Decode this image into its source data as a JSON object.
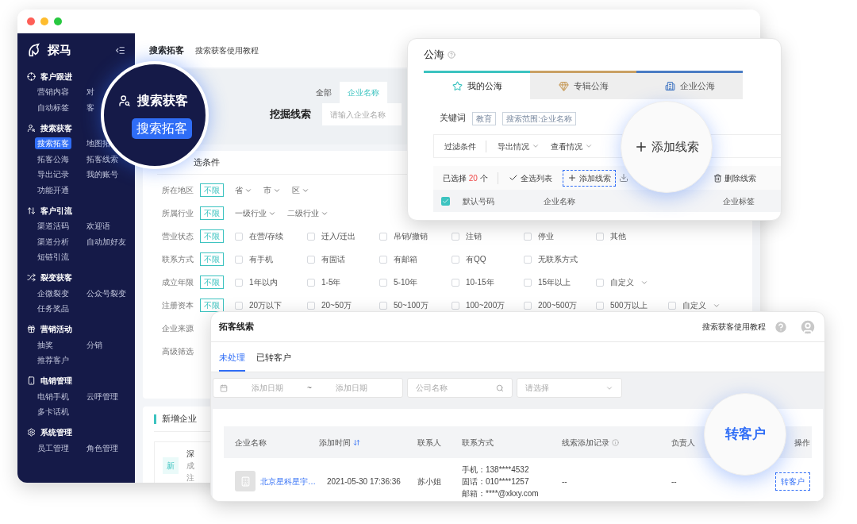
{
  "main_window": {
    "sidebar": {
      "logo": "探马",
      "groups": [
        {
          "title": "客户跟进",
          "items": [
            {
              "label": "营销内容",
              "selected": false
            },
            {
              "label": "对",
              "selected": false
            },
            {
              "label": "自动标签",
              "selected": false
            },
            {
              "label": "客",
              "selected": false
            }
          ]
        },
        {
          "title": "搜索获客",
          "items": [
            {
              "label": "搜索拓客",
              "selected": true
            },
            {
              "label": "地图拓",
              "selected": false
            },
            {
              "label": "拓客公海",
              "selected": false
            },
            {
              "label": "拓客线索",
              "selected": false
            },
            {
              "label": "导出记录",
              "selected": false
            },
            {
              "label": "我的账号",
              "selected": false
            },
            {
              "label": "功能开通",
              "selected": false
            }
          ]
        },
        {
          "title": "客户引流",
          "items": [
            {
              "label": "渠道活码",
              "selected": false
            },
            {
              "label": "欢迎语",
              "selected": false
            },
            {
              "label": "渠道分析",
              "selected": false
            },
            {
              "label": "自动加好友",
              "selected": false
            },
            {
              "label": "短链引流",
              "selected": false
            }
          ]
        },
        {
          "title": "裂变获客",
          "items": [
            {
              "label": "企微裂变",
              "selected": false
            },
            {
              "label": "公众号裂变",
              "selected": false
            },
            {
              "label": "任务奖品",
              "selected": false
            }
          ]
        },
        {
          "title": "营销活动",
          "items": [
            {
              "label": "抽奖",
              "selected": false
            },
            {
              "label": "分销",
              "selected": false
            },
            {
              "label": "推荐客户",
              "selected": false
            }
          ]
        },
        {
          "title": "电销管理",
          "items": [
            {
              "label": "电销手机",
              "selected": false
            },
            {
              "label": "云呼管理",
              "selected": false
            },
            {
              "label": "多卡话机",
              "selected": false
            }
          ]
        },
        {
          "title": "系统管理",
          "items": [
            {
              "label": "员工管理",
              "selected": false
            },
            {
              "label": "角色管理",
              "selected": false
            }
          ]
        }
      ]
    },
    "header": {
      "title": "搜索拓客",
      "link": "搜索获客使用教程"
    },
    "search": {
      "tabs": [
        {
          "label": "全部",
          "selected": false
        },
        {
          "label": "企业名称",
          "selected": true
        }
      ],
      "label": "挖掘线索",
      "placeholder": "请输入企业名称"
    },
    "filters": {
      "title": "选条件",
      "rows": [
        {
          "label": "所在地区",
          "tag": "不限",
          "options": [
            {
              "kind": "dropdown",
              "label": "省"
            },
            {
              "kind": "dropdown",
              "label": "市"
            },
            {
              "kind": "dropdown",
              "label": "区"
            }
          ]
        },
        {
          "label": "所属行业",
          "tag": "不限",
          "options": [
            {
              "kind": "dropdown",
              "label": "一级行业"
            },
            {
              "kind": "dropdown",
              "label": "二级行业"
            }
          ]
        },
        {
          "label": "营业状态",
          "tag": "不限",
          "options": [
            {
              "kind": "checkbox",
              "label": "在营/存续",
              "checked": false
            },
            {
              "kind": "checkbox",
              "label": "迁入/迁出",
              "checked": false
            },
            {
              "kind": "checkbox",
              "label": "吊销/撤销",
              "checked": false
            },
            {
              "kind": "checkbox",
              "label": "注销",
              "checked": false
            },
            {
              "kind": "checkbox",
              "label": "停业",
              "checked": false
            },
            {
              "kind": "checkbox",
              "label": "其他",
              "checked": false
            }
          ]
        },
        {
          "label": "联系方式",
          "tag": "不限",
          "options": [
            {
              "kind": "checkbox",
              "label": "有手机",
              "checked": false
            },
            {
              "kind": "checkbox",
              "label": "有固话",
              "checked": false
            },
            {
              "kind": "checkbox",
              "label": "有邮箱",
              "checked": false
            },
            {
              "kind": "checkbox",
              "label": "有QQ",
              "checked": false
            },
            {
              "kind": "checkbox",
              "label": "无联系方式",
              "checked": false
            }
          ]
        },
        {
          "label": "成立年限",
          "tag": "不限",
          "options": [
            {
              "kind": "checkbox",
              "label": "1年以内",
              "checked": false
            },
            {
              "kind": "checkbox",
              "label": "1-5年",
              "checked": false
            },
            {
              "kind": "checkbox",
              "label": "5-10年",
              "checked": false
            },
            {
              "kind": "checkbox",
              "label": "10-15年",
              "checked": false
            },
            {
              "kind": "checkbox",
              "label": "15年以上",
              "checked": false
            },
            {
              "kind": "checkbox_dropdown",
              "label": "自定义",
              "checked": false
            }
          ]
        },
        {
          "label": "注册资本",
          "tag": "不限",
          "options": [
            {
              "kind": "checkbox",
              "label": "20万以下",
              "checked": false
            },
            {
              "kind": "checkbox",
              "label": "20~50万",
              "checked": false
            },
            {
              "kind": "checkbox",
              "label": "50~100万",
              "checked": false
            },
            {
              "kind": "checkbox",
              "label": "100~200万",
              "checked": false
            },
            {
              "kind": "checkbox",
              "label": "200~500万",
              "checked": false
            },
            {
              "kind": "checkbox",
              "label": "500万以上",
              "checked": false
            },
            {
              "kind": "checkbox_dropdown",
              "label": "自定义",
              "checked": false
            }
          ]
        },
        {
          "label": "企业来源"
        },
        {
          "label": "高级筛选"
        }
      ]
    },
    "new_companies": {
      "title": "新增企业",
      "badge": "新",
      "texts": [
        "深",
        "成",
        "注"
      ]
    }
  },
  "magnifier": {
    "heading": "搜索获客",
    "pill": "搜索拓客"
  },
  "public_pool": {
    "title": "公海",
    "tabs": [
      {
        "label": "我的公海",
        "selected": true,
        "color": "#3cc3c0"
      },
      {
        "label": "专辑公海",
        "selected": false,
        "color": "#c9a063"
      },
      {
        "label": "企业公海",
        "selected": false,
        "color": "#4a7cc4"
      }
    ],
    "keyword": {
      "label": "关键词",
      "tags": [
        "教育",
        "搜索范围:企业名称"
      ]
    },
    "filter_bar": [
      {
        "label": "过滤条件",
        "kind": "plain"
      },
      {
        "label": "导出情况",
        "kind": "dropdown"
      },
      {
        "label": "查看情况",
        "kind": "dropdown"
      }
    ],
    "selection": {
      "label": "已选择",
      "count": "20",
      "unit": "个"
    },
    "actions": [
      {
        "kind": "check",
        "label": "全选列表",
        "highlighted": false
      },
      {
        "kind": "add",
        "label": "添加线索",
        "highlighted": true
      },
      {
        "kind": "download",
        "highlighted": false
      },
      {
        "kind": "delete",
        "label": "删除线索",
        "highlighted": false
      }
    ],
    "table": {
      "select_all_checked": true,
      "columns": [
        "默认号码",
        "企业名称",
        "企业标签"
      ]
    }
  },
  "add_callout": {
    "label": "添加线索"
  },
  "leads": {
    "title": "拓客线索",
    "help_link": "搜索获客使用教程",
    "tabs": [
      {
        "label": "未处理",
        "selected": true
      },
      {
        "label": "已转客户",
        "selected": false
      }
    ],
    "date_range": {
      "start_placeholder": "添加日期",
      "separator": "~",
      "end_placeholder": "添加日期"
    },
    "company_field": {
      "placeholder": "公司名称"
    },
    "select_field": {
      "placeholder": "请选择"
    },
    "table": {
      "columns": [
        "企业名称",
        "添加时间",
        "联系人",
        "联系方式",
        "线索添加记录",
        "负责人",
        "操作"
      ],
      "rows": [
        {
          "company": "北京星科星宇…",
          "time": "2021-05-30 17:36:36",
          "contact": "苏小姐",
          "methods": [
            "手机：138****4532",
            "固话：010****1257",
            "邮箱：****@xkxy.com"
          ],
          "record": "--",
          "owner": "--",
          "action": "转客户",
          "highlighted": true
        }
      ]
    }
  },
  "convert_callout": {
    "label": "转客户"
  }
}
